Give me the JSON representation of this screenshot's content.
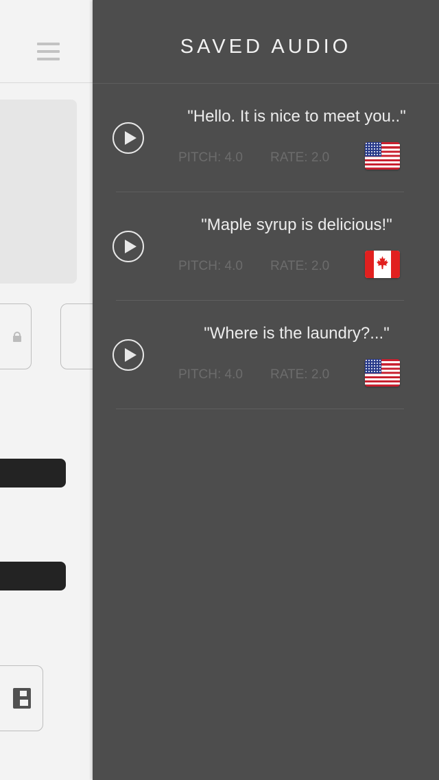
{
  "drawer": {
    "title": "SAVED AUDIO",
    "items": [
      {
        "quote": "\"Hello. It is nice to meet you..\"",
        "pitch": "PITCH: 4.0",
        "rate": "RATE: 2.0",
        "flag": "us-flag"
      },
      {
        "quote": "\"Maple syrup is delicious!\"",
        "pitch": "PITCH: 4.0",
        "rate": "RATE: 2.0",
        "flag": "canada-flag"
      },
      {
        "quote": "\"Where is the laundry?...\"",
        "pitch": "PITCH: 4.0",
        "rate": "RATE: 2.0",
        "flag": "us-flag"
      }
    ]
  },
  "icons": {
    "menu": "hamburger-menu-icon",
    "play": "play-icon",
    "lock": "lock-icon",
    "save": "floppy-disk-icon"
  },
  "colors": {
    "drawer_bg": "#4d4d4d",
    "main_bg": "#f3f3f3",
    "slider_bar": "#232323",
    "text_light": "#ececec",
    "text_muted": "#6c6c6c"
  }
}
